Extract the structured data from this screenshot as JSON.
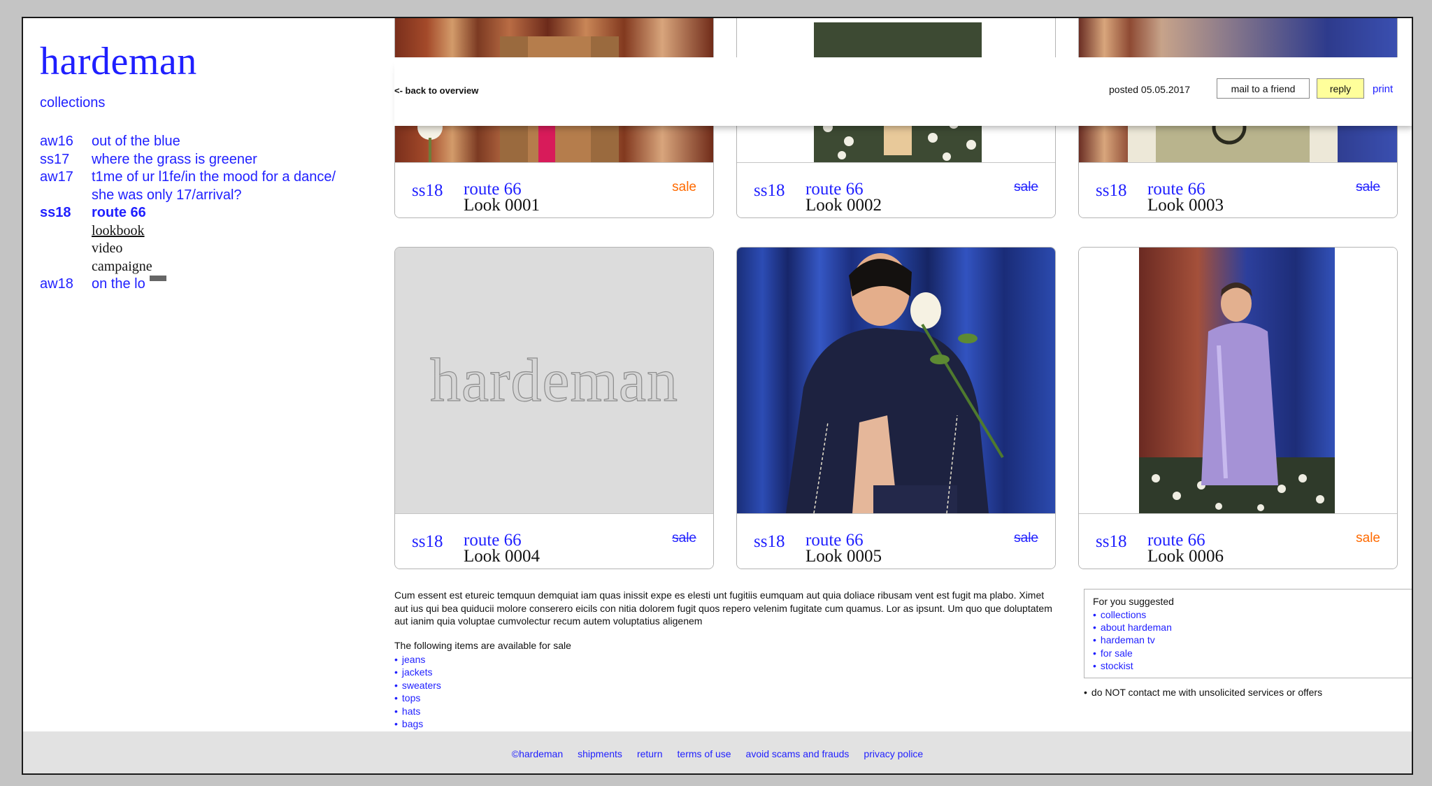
{
  "brand": "hardeman",
  "sidebar": {
    "title": "collections",
    "collections": [
      {
        "season": "aw16",
        "name": "out of the blue"
      },
      {
        "season": "ss17",
        "name": "where the grass is greener"
      },
      {
        "season": "aw17",
        "name": "t1me of ur l1fe/in the mood for a dance/ she was only 17/arrival?"
      },
      {
        "season": "ss18",
        "name": "route 66"
      },
      {
        "season": "aw18",
        "name": "on the lo"
      }
    ],
    "sub_items": [
      "lookbook",
      "video",
      "campaigne"
    ]
  },
  "topbar": {
    "back": "<- back to overview",
    "posted": "posted 05.05.2017",
    "mail": "mail to a friend",
    "reply": "reply",
    "print": "print"
  },
  "cards": [
    {
      "season": "ss18",
      "collection": "route 66",
      "look": "Look 0001",
      "sale": "sale",
      "sale_state": "available"
    },
    {
      "season": "ss18",
      "collection": "route 66",
      "look": "Look 0002",
      "sale": "sale",
      "sale_state": "struck"
    },
    {
      "season": "ss18",
      "collection": "route 66",
      "look": "Look 0003",
      "sale": "sale",
      "sale_state": "struck"
    },
    {
      "season": "ss18",
      "collection": "route 66",
      "look": "Look 0004",
      "sale": "sale",
      "sale_state": "struck",
      "placeholder": "hardeman"
    },
    {
      "season": "ss18",
      "collection": "route 66",
      "look": "Look 0005",
      "sale": "sale",
      "sale_state": "struck"
    },
    {
      "season": "ss18",
      "collection": "route 66",
      "look": "Look 0006",
      "sale": "sale",
      "sale_state": "available"
    }
  ],
  "description": "Cum essent est etureic temquun demquiat iam quas inissit expe es elesti unt fugitiis eumquam aut quia doliace ribusam vent est fugit ma plabo. Ximet aut ius qui bea quiducii molore conserero eicils con nitia dolorem fugit quos repero velenim fugitate cum quamus. Lor as ipsunt. Um quo que doluptatem aut ianim quia voluptae cumvolectur recum autem voluptatius aligenem",
  "for_sale": {
    "title": "The following items are available for sale",
    "items": [
      "jeans",
      "jackets",
      "sweaters",
      "tops",
      "hats",
      "bags"
    ]
  },
  "suggested": {
    "title": "For you suggested",
    "items": [
      "collections",
      "about hardeman",
      "hardeman tv",
      "for sale",
      "stockist"
    ]
  },
  "disclaimer": "do NOT contact me with unsolicited services or offers",
  "footer": [
    "©hardeman",
    "shipments",
    "return",
    "terms of use",
    "avoid scams and frauds",
    "privacy police"
  ],
  "colors": {
    "link": "#1f1fff",
    "sale_active": "#ff6a00",
    "reply_bg": "#ffff9b",
    "footer_bg": "#e2e2e2"
  }
}
